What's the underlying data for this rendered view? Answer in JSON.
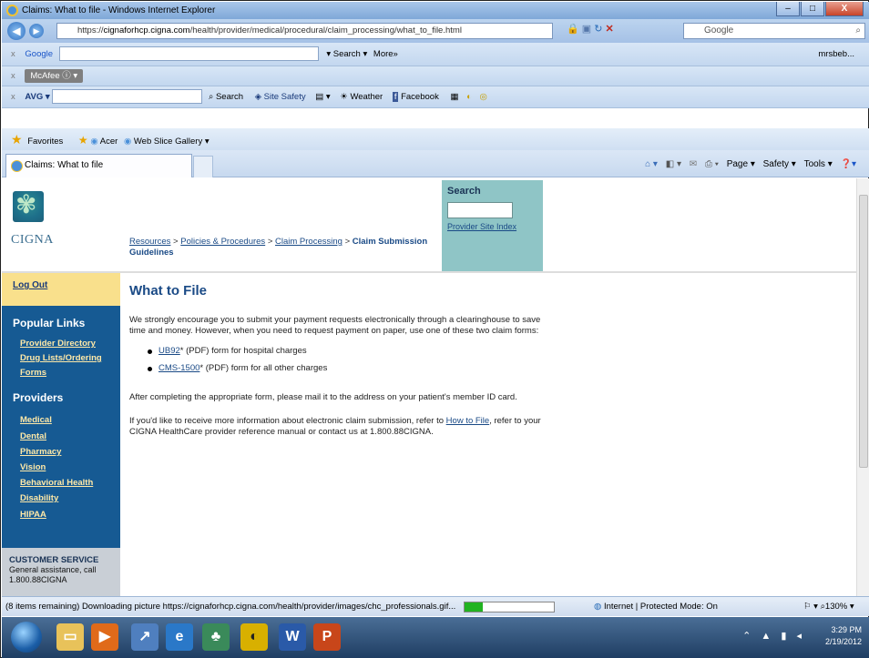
{
  "window": {
    "title": "Claims: What to file - Windows Internet Explorer",
    "min": "–",
    "max": "□",
    "close": "X"
  },
  "address": {
    "url_prefix": "https://",
    "url_host": "cignaforhcp.cigna.com",
    "url_path": "/health/provider/medical/procedural/claim_processing/what_to_file.html",
    "search_placeholder": "Google"
  },
  "toolbars": {
    "google": {
      "label": "Google",
      "search": "Search",
      "more": "More»",
      "user": "mrsbeb..."
    },
    "mcafee": {
      "label": "McAfee"
    },
    "avg": {
      "label": "AVG",
      "search": "Search",
      "site_safety": "Site Safety",
      "weather": "Weather",
      "facebook": "Facebook"
    }
  },
  "favorites": {
    "label": "Favorites",
    "acer": "Acer",
    "web_slice": "Web Slice Gallery ▾"
  },
  "tab": {
    "title": "Claims: What to file"
  },
  "commandbar": {
    "page": "Page ▾",
    "safety": "Safety ▾",
    "tools": "Tools ▾",
    "help": "❓▾"
  },
  "site": {
    "logo_text": "CIGNA",
    "breadcrumbs": {
      "resources": "Resources",
      "policies": "Policies & Procedures",
      "claim_processing": "Claim Processing",
      "current": "Claim Submission Guidelines",
      "sep": " > "
    },
    "search": {
      "label": "Search",
      "index_link": "Provider Site Index"
    },
    "nav": {
      "logout": "Log Out",
      "popular_heading": "Popular Links",
      "popular": [
        "Provider Directory",
        "Drug Lists/Ordering",
        "Forms"
      ],
      "providers_heading": "Providers",
      "providers": [
        "Medical",
        "Dental",
        "Pharmacy",
        "Vision",
        "Behavioral Health",
        "Disability",
        "HIPAA"
      ],
      "customer_service_heading": "CUSTOMER SERVICE",
      "customer_service_text": "General assistance, call",
      "customer_service_phone": "1.800.88CIGNA"
    },
    "main": {
      "title": "What to File",
      "intro": "We strongly encourage you to submit your payment requests electronically through a clearinghouse to save time and money. However, when you need to request payment on paper, use one of these two claim forms:",
      "forms": [
        {
          "link": "UB92",
          "text": "* (PDF) form for hospital charges"
        },
        {
          "link": "CMS-1500",
          "text": "* (PDF) form for all other charges"
        }
      ],
      "after": "After completing the appropriate form, please mail it to the address on your patient's member ID card.",
      "more_pre": "If you'd like to receive more information about electronic claim submission, refer to ",
      "more_link": "How to File",
      "more_post": ", refer to your CIGNA HealthCare provider reference manual or contact us at 1.800.88CIGNA."
    }
  },
  "status": {
    "message": "(8 items remaining) Downloading picture https://cignaforhcp.cigna.com/health/provider/images/chc_professionals.gif...",
    "progress": 0.2,
    "zone": "Internet | Protected Mode: On",
    "zoom": "130%"
  },
  "taskbar": {
    "time": "3:29 PM",
    "date": "2/19/2012"
  }
}
